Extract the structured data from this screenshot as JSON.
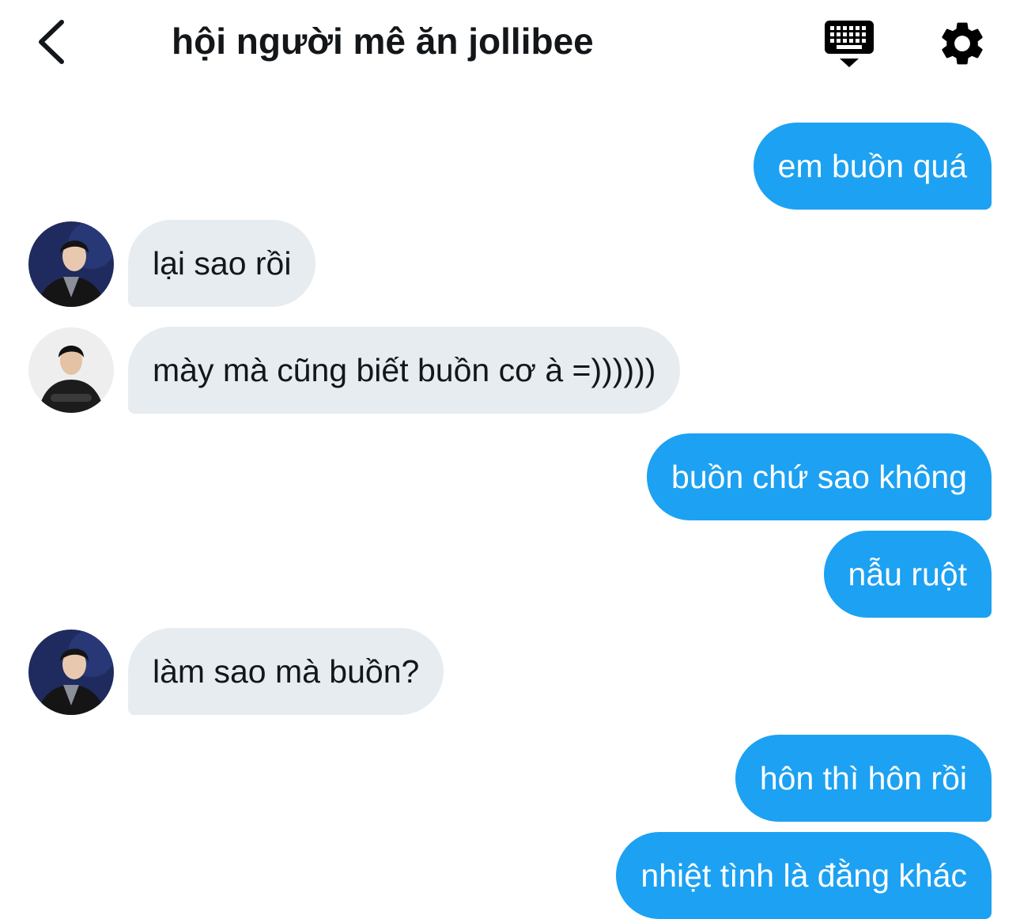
{
  "header": {
    "title": "hội người mê ăn jollibee"
  },
  "icons": {
    "back": "chevron-left-icon",
    "keyboard": "keyboard-icon",
    "settings": "gear-icon"
  },
  "colors": {
    "outgoing_bubble": "#1da1f2",
    "incoming_bubble": "#e6ecf0",
    "outgoing_text": "#ffffff",
    "incoming_text": "#14171a"
  },
  "messages": [
    {
      "direction": "outgoing",
      "text": "em buồn quá"
    },
    {
      "direction": "incoming",
      "avatar": "avatar-a",
      "text": "lại sao rồi"
    },
    {
      "direction": "incoming",
      "avatar": "avatar-b",
      "text": "mày mà cũng biết buồn cơ à =))))))"
    },
    {
      "direction": "outgoing",
      "text": "buồn chứ sao không"
    },
    {
      "direction": "outgoing",
      "text": "nẫu ruột"
    },
    {
      "direction": "incoming",
      "avatar": "avatar-a",
      "text": "làm sao mà buồn?"
    },
    {
      "direction": "outgoing",
      "text": "hôn thì hôn rồi"
    },
    {
      "direction": "outgoing",
      "text": "nhiệt tình là đằng khác"
    }
  ]
}
